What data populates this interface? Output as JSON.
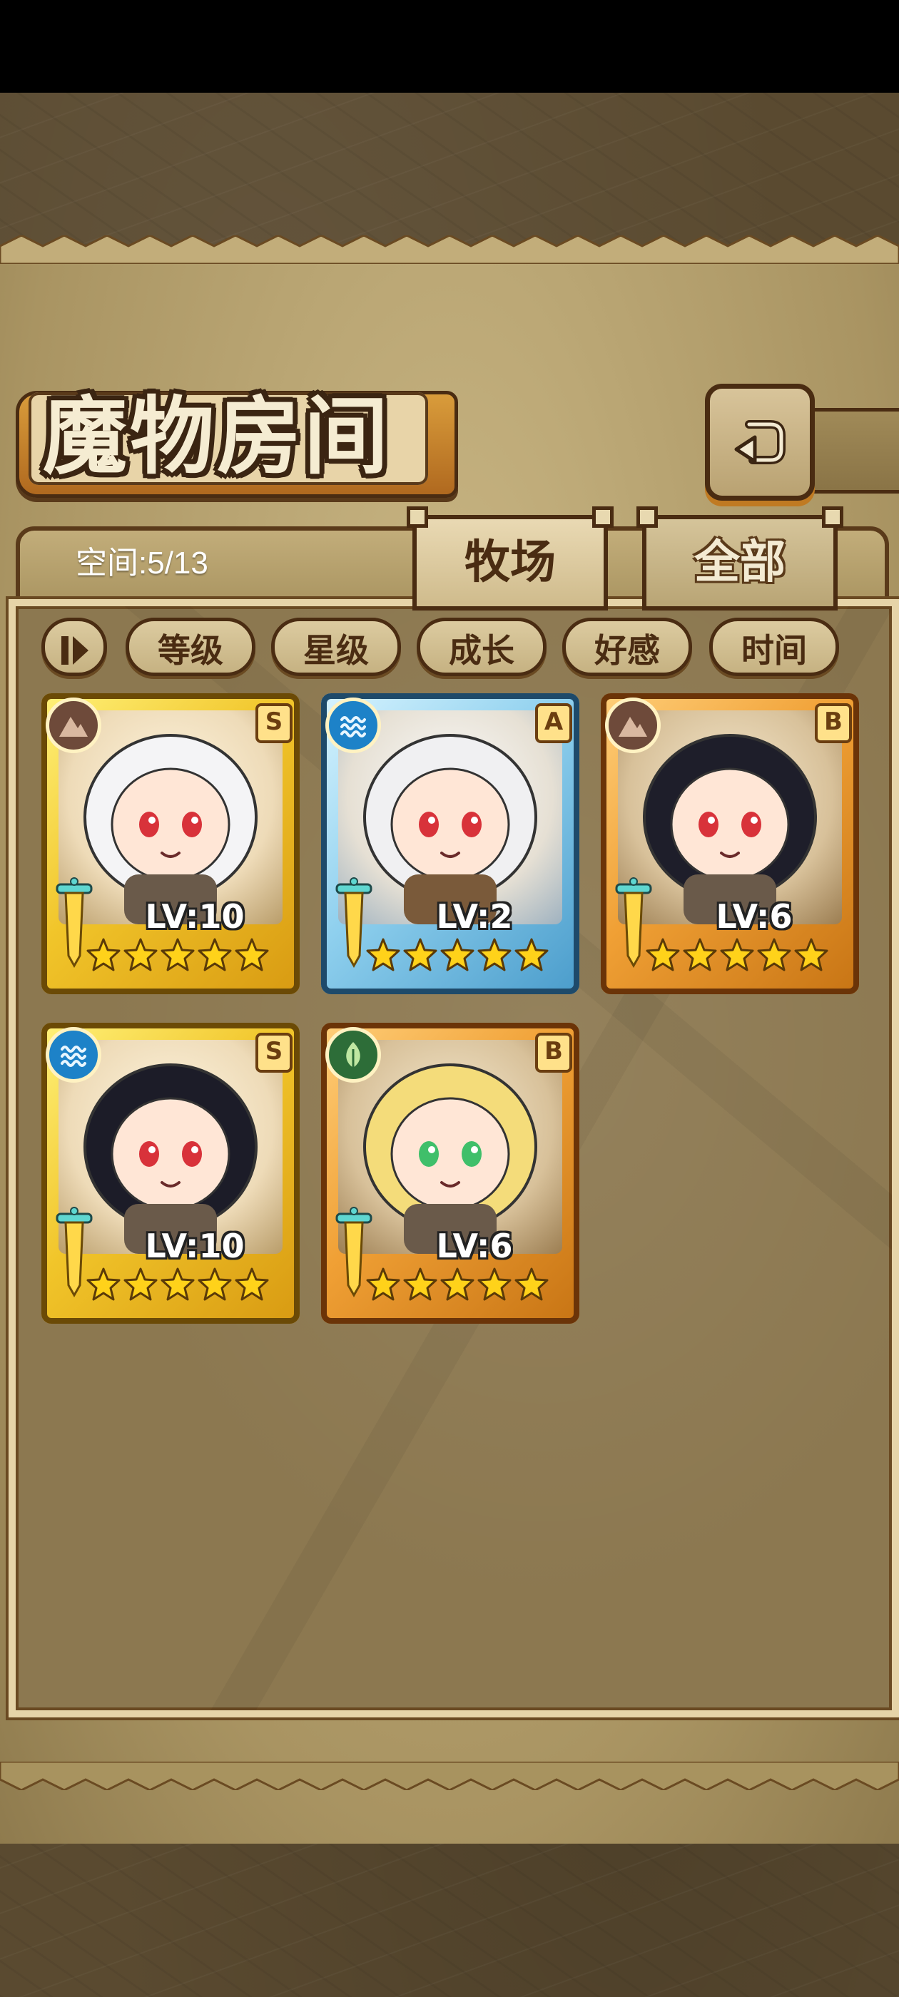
{
  "header": {
    "title": "魔物房间",
    "back_icon": "return-arrow-icon"
  },
  "tabs": {
    "space_label": "空间:5/13",
    "items": [
      {
        "label": "牧场",
        "active": true
      },
      {
        "label": "全部",
        "active": false
      }
    ]
  },
  "sort": {
    "toggle_icon": "pause-sort-icon",
    "buttons": [
      "等级",
      "星级",
      "成长",
      "好感",
      "时间"
    ]
  },
  "monsters": [
    {
      "level": "LV:10",
      "rank": "S",
      "element": "earth-icon",
      "stars": 5,
      "frame": "gold"
    },
    {
      "level": "LV:2",
      "rank": "A",
      "element": "water-icon",
      "stars": 5,
      "frame": "blue"
    },
    {
      "level": "LV:6",
      "rank": "B",
      "element": "earth-icon",
      "stars": 5,
      "frame": "orange"
    },
    {
      "level": "LV:10",
      "rank": "S",
      "element": "water-icon",
      "stars": 5,
      "frame": "gold"
    },
    {
      "level": "LV:6",
      "rank": "B",
      "element": "nature-icon",
      "stars": 5,
      "frame": "orange"
    }
  ],
  "colors": {
    "parchment": "#c9b684",
    "border_dark": "#4a2c12",
    "accent_orange": "#c07a22",
    "star_yellow": "#ffd21a"
  }
}
